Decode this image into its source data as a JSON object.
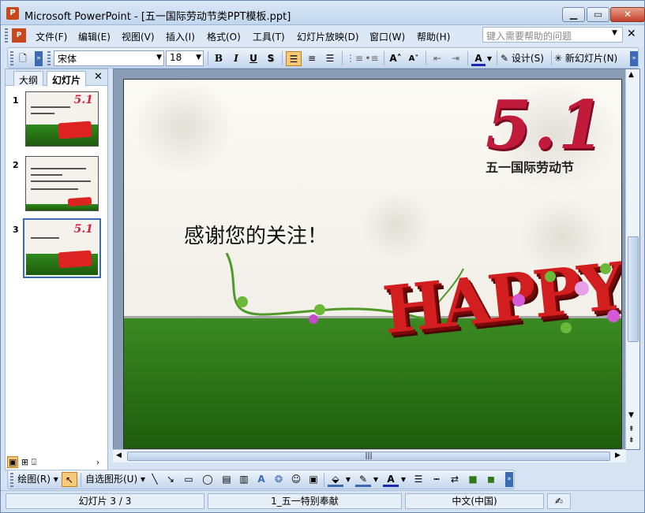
{
  "window": {
    "title": "Microsoft PowerPoint - [五一国际劳动节类PPT模板.ppt]",
    "app_icon": "powerpoint-icon"
  },
  "menu": {
    "items": [
      "文件(F)",
      "编辑(E)",
      "视图(V)",
      "插入(I)",
      "格式(O)",
      "工具(T)",
      "幻灯片放映(D)",
      "窗口(W)",
      "帮助(H)"
    ],
    "help_placeholder": "键入需要帮助的问题"
  },
  "format_toolbar": {
    "font_name": "宋体",
    "font_size": "18",
    "bold": "B",
    "italic": "I",
    "underline": "U",
    "shadow": "S",
    "font_color_letter": "A",
    "design_label": "设计(S)",
    "new_slide_label": "新幻灯片(N)"
  },
  "slides_panel": {
    "tabs": [
      "大纲",
      "幻灯片"
    ],
    "active_tab": "幻灯片",
    "slide_numbers": [
      "1",
      "2",
      "3"
    ],
    "selected": "3"
  },
  "slide": {
    "logo_number": "5.1",
    "logo_caption": "五一国际劳动节",
    "heading": "感谢您的关注！",
    "happy_text": "HAPPY"
  },
  "draw_toolbar": {
    "draw_label": "绘图(R)",
    "autoshapes_label": "自选图形(U)"
  },
  "status": {
    "slide_info": "幻灯片 3 / 3",
    "design_name": "1_五一特别奉献",
    "language": "中文(中国)"
  },
  "colors": {
    "accent": "#c21a3b",
    "ground": "#2e7a18",
    "chrome": "#d6e3f3"
  }
}
